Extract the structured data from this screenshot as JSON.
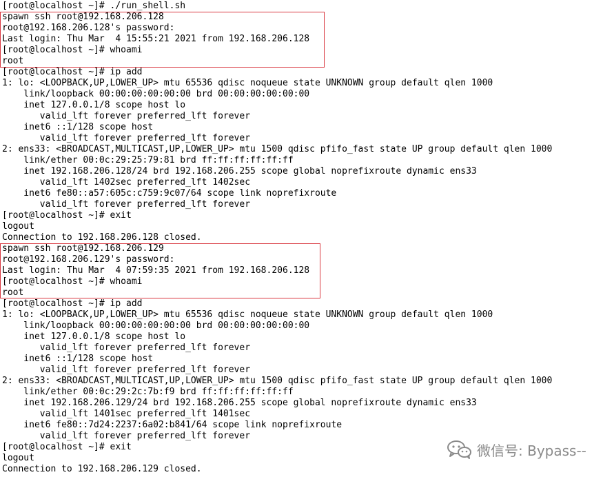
{
  "terminal": {
    "lines": [
      "[root@localhost ~]# ./run_shell.sh",
      "spawn ssh root@192.168.206.128",
      "root@192.168.206.128's password:",
      "Last login: Thu Mar  4 15:55:21 2021 from 192.168.206.128",
      "[root@localhost ~]# whoami",
      "root",
      "[root@localhost ~]# ip add",
      "1: lo: <LOOPBACK,UP,LOWER_UP> mtu 65536 qdisc noqueue state UNKNOWN group default qlen 1000",
      "    link/loopback 00:00:00:00:00:00 brd 00:00:00:00:00:00",
      "    inet 127.0.0.1/8 scope host lo",
      "       valid_lft forever preferred_lft forever",
      "    inet6 ::1/128 scope host",
      "       valid_lft forever preferred_lft forever",
      "2: ens33: <BROADCAST,MULTICAST,UP,LOWER_UP> mtu 1500 qdisc pfifo_fast state UP group default qlen 1000",
      "    link/ether 00:0c:29:25:79:81 brd ff:ff:ff:ff:ff:ff",
      "    inet 192.168.206.128/24 brd 192.168.206.255 scope global noprefixroute dynamic ens33",
      "       valid_lft 1402sec preferred_lft 1402sec",
      "    inet6 fe80::a57:605c:c759:9c07/64 scope link noprefixroute",
      "       valid_lft forever preferred_lft forever",
      "[root@localhost ~]# exit",
      "logout",
      "Connection to 192.168.206.128 closed.",
      "spawn ssh root@192.168.206.129",
      "root@192.168.206.129's password:",
      "Last login: Thu Mar  4 07:59:35 2021 from 192.168.206.128",
      "[root@localhost ~]# whoami",
      "root",
      "[root@localhost ~]# ip add",
      "1: lo: <LOOPBACK,UP,LOWER_UP> mtu 65536 qdisc noqueue state UNKNOWN group default qlen 1000",
      "    link/loopback 00:00:00:00:00:00 brd 00:00:00:00:00:00",
      "    inet 127.0.0.1/8 scope host lo",
      "       valid_lft forever preferred_lft forever",
      "    inet6 ::1/128 scope host",
      "       valid_lft forever preferred_lft forever",
      "2: ens33: <BROADCAST,MULTICAST,UP,LOWER_UP> mtu 1500 qdisc pfifo_fast state UP group default qlen 1000",
      "    link/ether 00:0c:29:2c:7b:f9 brd ff:ff:ff:ff:ff:ff",
      "    inet 192.168.206.129/24 brd 192.168.206.255 scope global noprefixroute dynamic ens33",
      "       valid_lft 1401sec preferred_lft 1401sec",
      "    inet6 fe80::7d24:2237:6a02:b841/64 scope link noprefixroute",
      "       valid_lft forever preferred_lft forever",
      "[root@localhost ~]# exit",
      "logout",
      "Connection to 192.168.206.129 closed."
    ]
  },
  "watermark": {
    "icon": "wechat-icon",
    "text": "微信号: Bypass--"
  },
  "colors": {
    "background": "#ffffff",
    "text": "#000000",
    "highlight_box": "#d9363e",
    "watermark": "#8a8a8a"
  }
}
